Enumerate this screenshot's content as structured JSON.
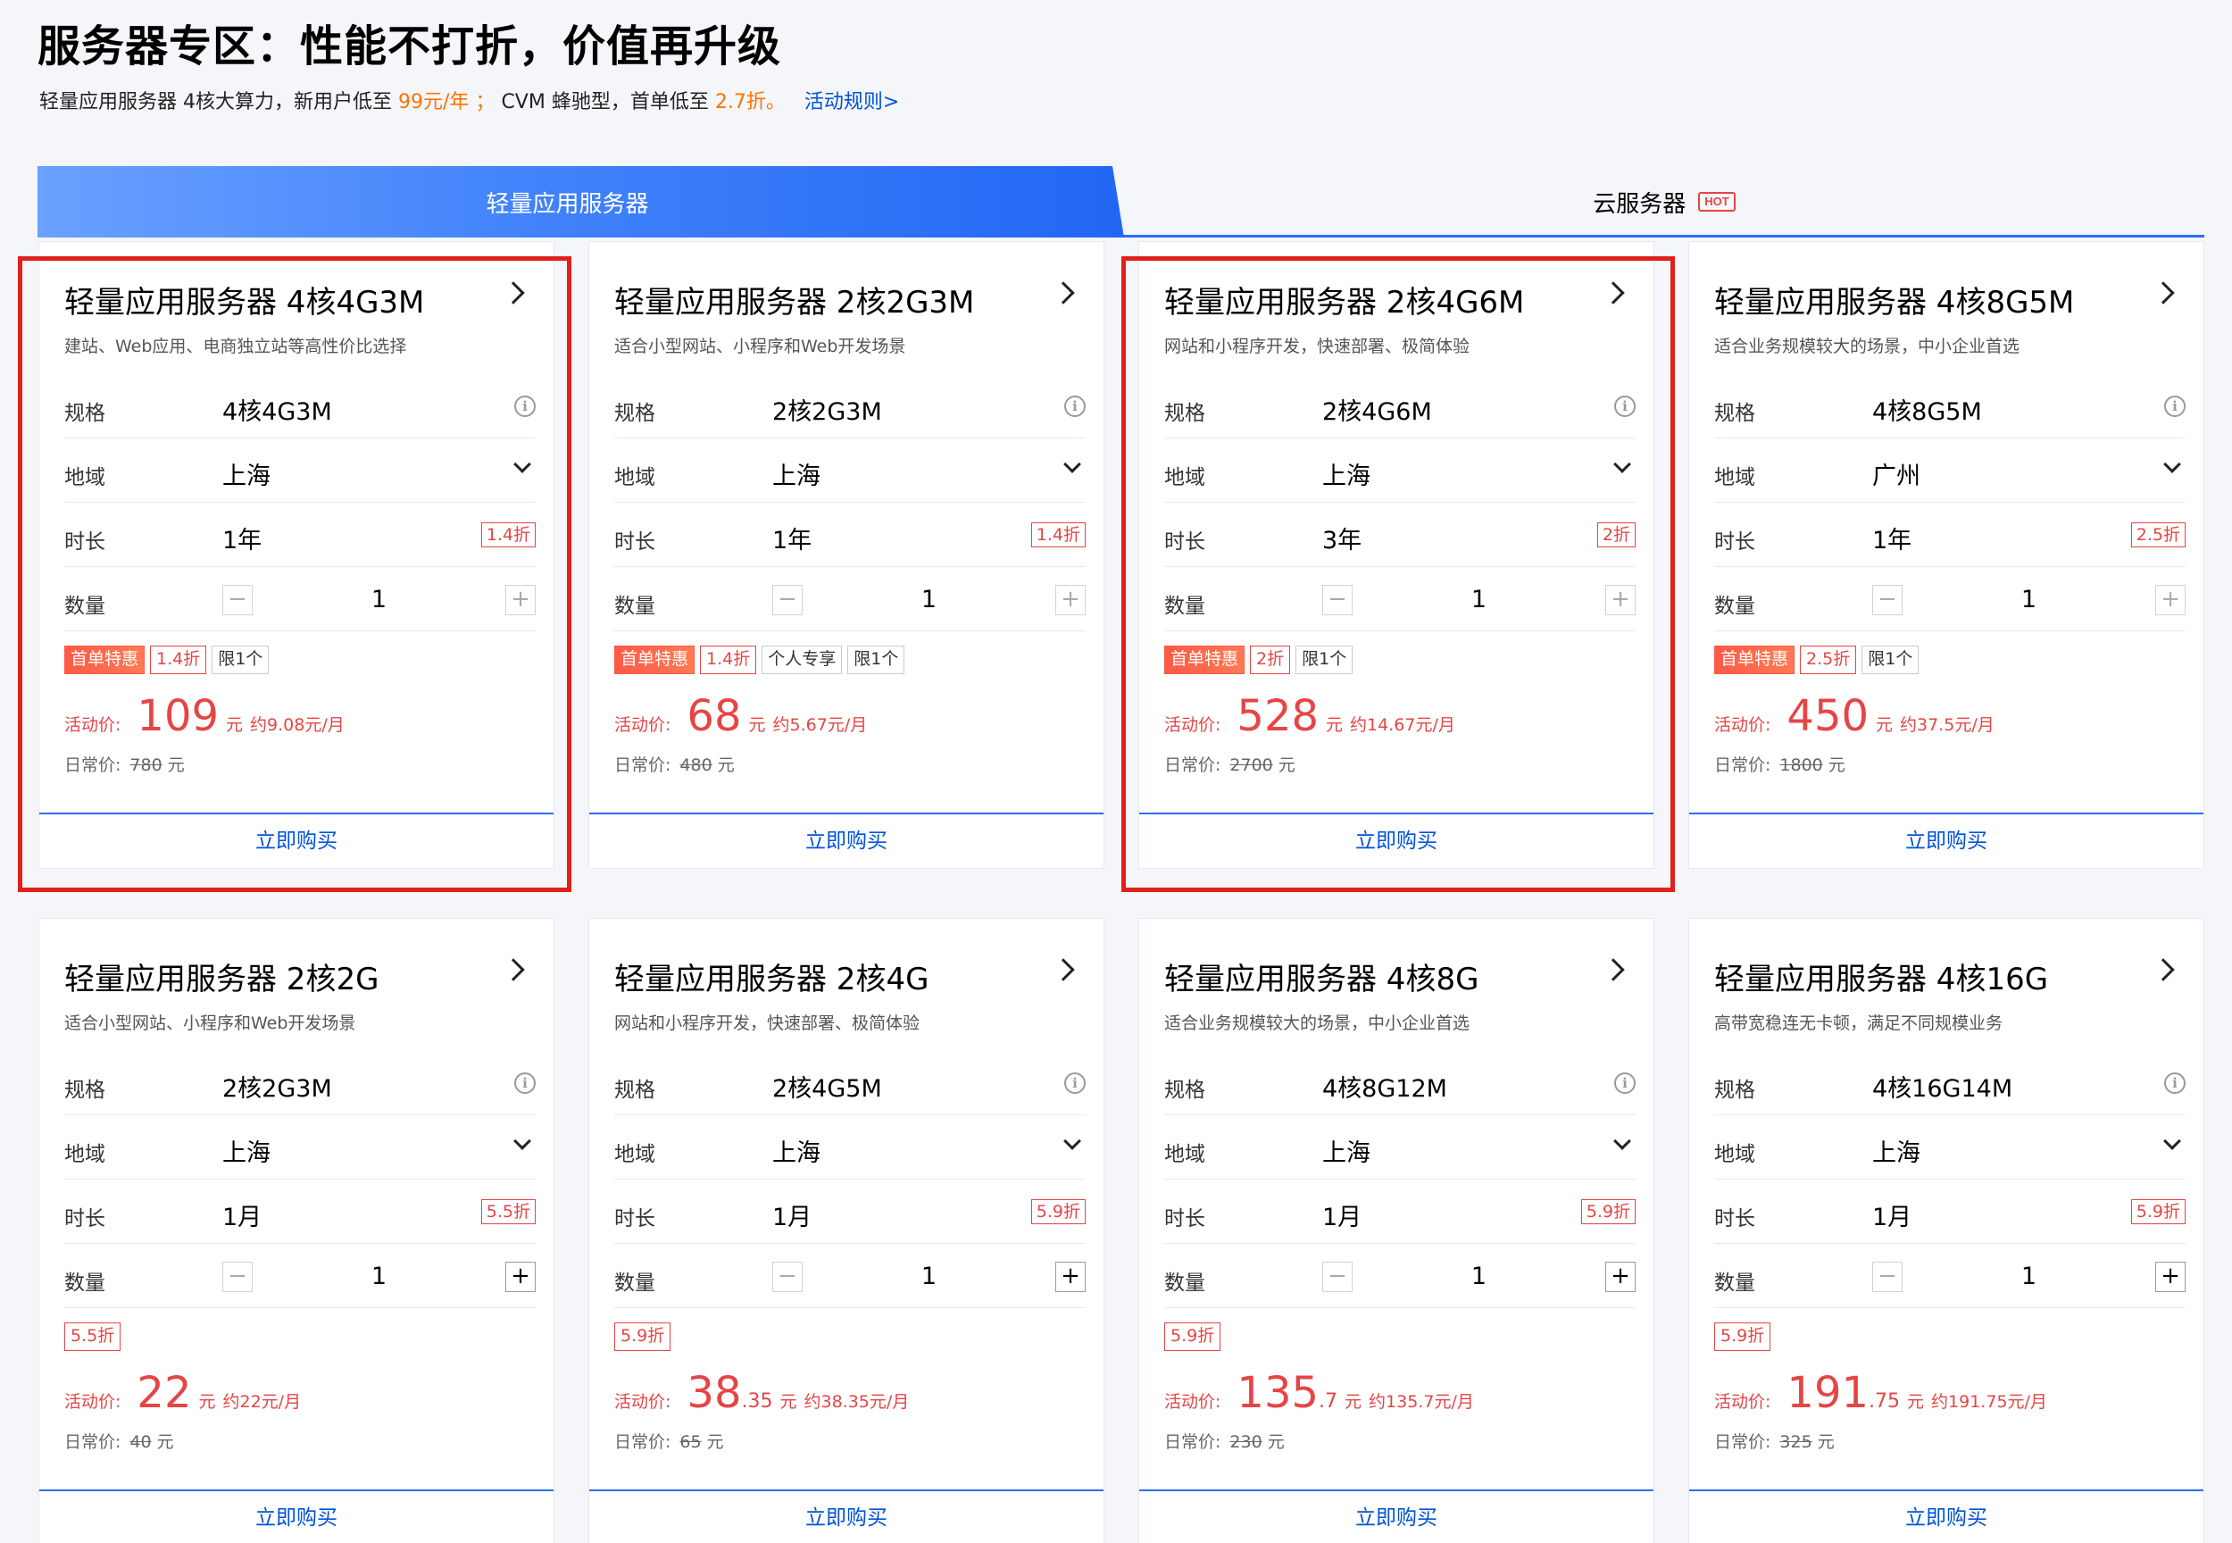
{
  "header": {
    "title": "服务器专区：性能不打折，价值再升级",
    "sub_part1": "轻量应用服务器 4核大算力，新用户低至",
    "sub_price1": "99元/年",
    "sub_sep": "；",
    "sub_part2": "CVM 蜂驰型，首单低至",
    "sub_price2": "2.7折。",
    "rules_link": "活动规则>"
  },
  "tabs": {
    "active": "轻量应用服务器",
    "inactive": "云服务器",
    "hot": "HOT"
  },
  "labels": {
    "spec": "规格",
    "region": "地域",
    "duration": "时长",
    "quantity": "数量",
    "activity_price": "活动价:",
    "regular_price": "日常价:",
    "yuan": "元",
    "buy": "立即购买",
    "first_order": "首单特惠"
  },
  "colors": {
    "accent": "#0052d9",
    "price": "#e54545",
    "highlight": "#e0201a"
  },
  "cards": [
    {
      "title": "轻量应用服务器 4核4G3M",
      "desc": "建站、Web应用、电商独立站等高性价比选择",
      "spec": "4核4G3M",
      "region": "上海",
      "duration": "1年",
      "discount": "1.4折",
      "qty": "1",
      "tags": [
        "首单特惠",
        "1.4折",
        "限1个"
      ],
      "price_int": "109",
      "price_dec": "",
      "per_month": "约9.08元/月",
      "orig": "780",
      "plus_active": false
    },
    {
      "title": "轻量应用服务器 2核2G3M",
      "desc": "适合小型网站、小程序和Web开发场景",
      "spec": "2核2G3M",
      "region": "上海",
      "duration": "1年",
      "discount": "1.4折",
      "qty": "1",
      "tags": [
        "首单特惠",
        "1.4折",
        "个人专享",
        "限1个"
      ],
      "price_int": "68",
      "price_dec": "",
      "per_month": "约5.67元/月",
      "orig": "480",
      "plus_active": false
    },
    {
      "title": "轻量应用服务器 2核4G6M",
      "desc": "网站和小程序开发，快速部署、极简体验",
      "spec": "2核4G6M",
      "region": "上海",
      "duration": "3年",
      "discount": "2折",
      "qty": "1",
      "tags": [
        "首单特惠",
        "2折",
        "限1个"
      ],
      "price_int": "528",
      "price_dec": "",
      "per_month": "约14.67元/月",
      "orig": "2700",
      "plus_active": false
    },
    {
      "title": "轻量应用服务器 4核8G5M",
      "desc": "适合业务规模较大的场景，中小企业首选",
      "spec": "4核8G5M",
      "region": "广州",
      "duration": "1年",
      "discount": "2.5折",
      "qty": "1",
      "tags": [
        "首单特惠",
        "2.5折",
        "限1个"
      ],
      "price_int": "450",
      "price_dec": "",
      "per_month": "约37.5元/月",
      "orig": "1800",
      "plus_active": false
    },
    {
      "title": "轻量应用服务器 2核2G",
      "desc": "适合小型网站、小程序和Web开发场景",
      "spec": "2核2G3M",
      "region": "上海",
      "duration": "1月",
      "discount": "5.5折",
      "qty": "1",
      "tags": [
        "5.5折"
      ],
      "price_int": "22",
      "price_dec": "",
      "per_month": "约22元/月",
      "orig": "40",
      "plus_active": true
    },
    {
      "title": "轻量应用服务器 2核4G",
      "desc": "网站和小程序开发，快速部署、极简体验",
      "spec": "2核4G5M",
      "region": "上海",
      "duration": "1月",
      "discount": "5.9折",
      "qty": "1",
      "tags": [
        "5.9折"
      ],
      "price_int": "38",
      "price_dec": ".35",
      "per_month": "约38.35元/月",
      "orig": "65",
      "plus_active": true
    },
    {
      "title": "轻量应用服务器 4核8G",
      "desc": "适合业务规模较大的场景，中小企业首选",
      "spec": "4核8G12M",
      "region": "上海",
      "duration": "1月",
      "discount": "5.9折",
      "qty": "1",
      "tags": [
        "5.9折"
      ],
      "price_int": "135",
      "price_dec": ".7",
      "per_month": "约135.7元/月",
      "orig": "230",
      "plus_active": true
    },
    {
      "title": "轻量应用服务器 4核16G",
      "desc": "高带宽稳连无卡顿，满足不同规模业务",
      "spec": "4核16G14M",
      "region": "上海",
      "duration": "1月",
      "discount": "5.9折",
      "qty": "1",
      "tags": [
        "5.9折"
      ],
      "price_int": "191",
      "price_dec": ".75",
      "per_month": "约191.75元/月",
      "orig": "325",
      "plus_active": true
    }
  ]
}
